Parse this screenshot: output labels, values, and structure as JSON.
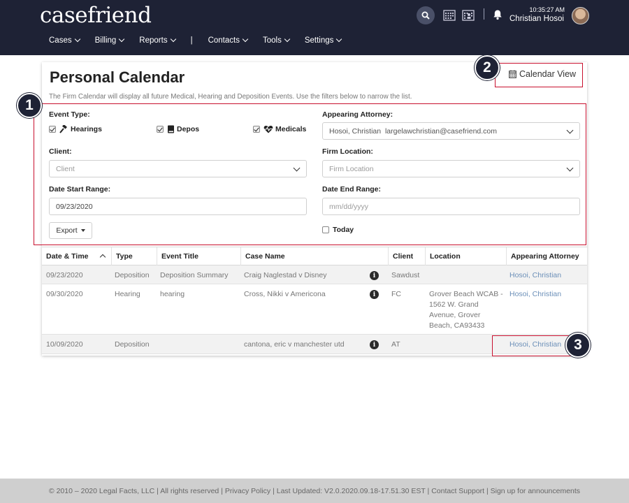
{
  "header": {
    "logo": "casefriend",
    "time": "10:35:27 AM",
    "user_name": "Christian Hosoi",
    "nav": [
      {
        "label": "Cases"
      },
      {
        "label": "Billing"
      },
      {
        "label": "Reports"
      },
      {
        "label": "Contacts"
      },
      {
        "label": "Tools"
      },
      {
        "label": "Settings"
      }
    ],
    "nav_separator": "|"
  },
  "page": {
    "title": "Personal Calendar",
    "calendar_view_label": "Calendar View",
    "description": "The Firm Calendar will display all future Medical, Hearing and Deposition Events. Use the filters below to narrow the list."
  },
  "filters": {
    "event_type_label": "Event Type:",
    "event_types": [
      {
        "label": "Hearings",
        "checked": true
      },
      {
        "label": "Depos",
        "checked": true
      },
      {
        "label": "Medicals",
        "checked": true
      }
    ],
    "appearing_attorney_label": "Appearing Attorney:",
    "appearing_attorney_value": "Hosoi, Christian  largelawchristian@casefriend.com",
    "client_label": "Client:",
    "client_placeholder": "Client",
    "firm_location_label": "Firm Location:",
    "firm_location_placeholder": "Firm Location",
    "date_start_label": "Date Start Range:",
    "date_start_value": "09/23/2020",
    "date_end_label": "Date End Range:",
    "date_end_placeholder": "mm/dd/yyyy",
    "export_label": "Export",
    "today_label": "Today",
    "today_checked": false
  },
  "table": {
    "columns": [
      "Date & Time",
      "Type",
      "Event Title",
      "Case Name",
      "Client",
      "Location",
      "Appearing Attorney"
    ],
    "rows": [
      {
        "date": "09/23/2020",
        "type": "Deposition",
        "title": "Deposition Summary",
        "case": "Craig Naglestad v Disney",
        "client": "Sawdust",
        "location": "",
        "attorney": "Hosoi, Christian"
      },
      {
        "date": "09/30/2020",
        "type": "Hearing",
        "title": "hearing",
        "case": "Cross, Nikki v Americona",
        "client": "FC",
        "location": "Grover Beach WCAB - 1562 W. Grand Avenue, Grover Beach, CA93433",
        "attorney": "Hosoi, Christian"
      },
      {
        "date": "10/09/2020",
        "type": "Deposition",
        "title": "",
        "case": "cantona, eric v manchester utd",
        "client": "AT",
        "location": "",
        "attorney": "Hosoi, Christian"
      }
    ]
  },
  "annotations": {
    "badge1": "1",
    "badge2": "2",
    "badge3": "3",
    "color": "#c8102e"
  },
  "footer": {
    "text": "© 2010 – 2020 Legal Facts, LLC | All rights reserved | Privacy Policy | Last Updated: V2.0.2020.09.18-17.51.30 EST | Contact Support | Sign up for announcements"
  },
  "colors": {
    "header_bg": "#1e2235",
    "link": "#6b8fb8",
    "annotation": "#c8102e"
  }
}
